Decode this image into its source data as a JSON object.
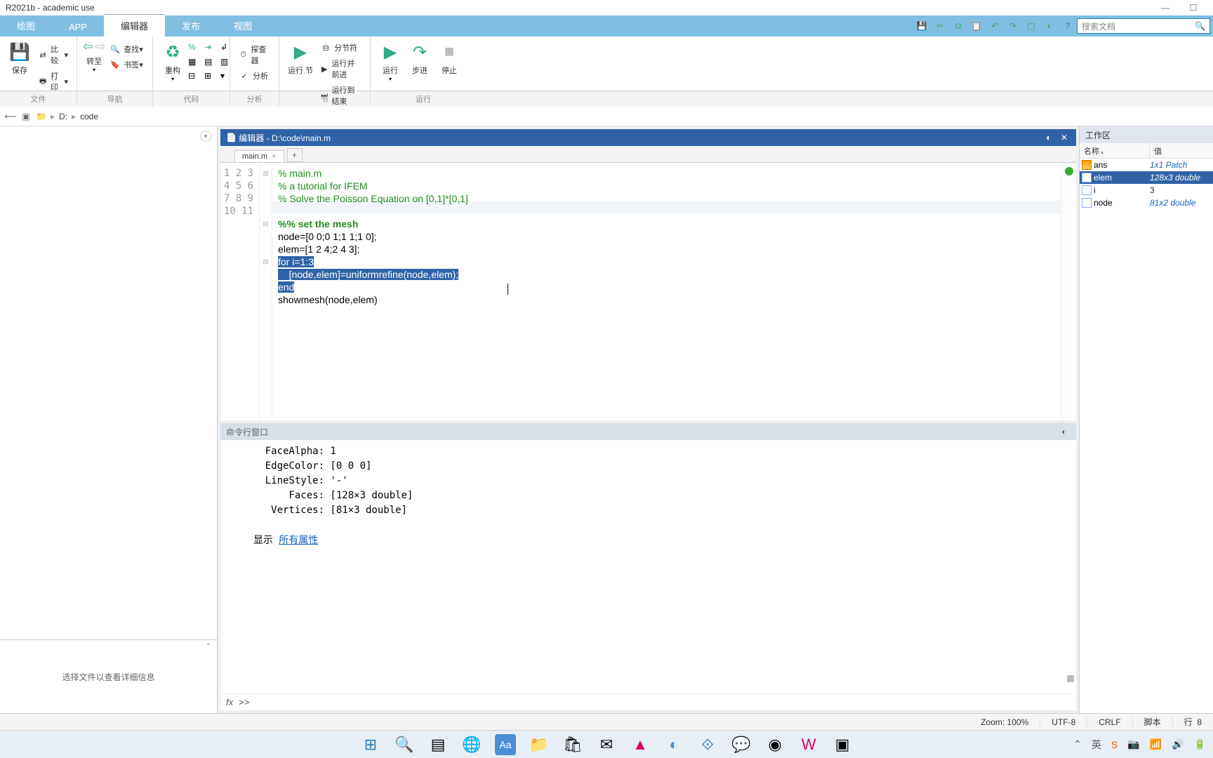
{
  "title": "R2021b - academic use",
  "tabs": [
    "绘图",
    "APP",
    "编辑器",
    "发布",
    "视图"
  ],
  "activeTab": "编辑器",
  "searchPlaceholder": "搜索文档",
  "ribbon": {
    "file": {
      "save": "保存",
      "compare": "比较",
      "print": "打印"
    },
    "nav": {
      "nav": "转至",
      "find": "查找",
      "bookmark": "书签"
    },
    "refactor": "重构",
    "analyze": {
      "explore": "探查器",
      "analyze": "分析"
    },
    "section": {
      "runsection": "运行\n节",
      "break": "分节符",
      "runadvance": "运行并前进",
      "runend": "运行到结束"
    },
    "run": {
      "run": "运行",
      "step": "步进",
      "stop": "停止"
    },
    "labels": [
      "文件",
      "导航",
      "代码",
      "分析",
      "节",
      "运行"
    ]
  },
  "path": {
    "drive": "D:",
    "folder": "code"
  },
  "editorTitle": "编辑器 - D:\\code\\main.m",
  "fileTab": "main.m",
  "code": {
    "lines": [
      {
        "n": 1,
        "type": "comment",
        "text": "% main.m"
      },
      {
        "n": 2,
        "type": "comment",
        "text": "% a tutorial for IFEM"
      },
      {
        "n": 3,
        "type": "comment",
        "text": "% Solve the Poisson Equation on [0,1]*[0,1]"
      },
      {
        "n": 4,
        "type": "blank",
        "text": ""
      },
      {
        "n": 5,
        "type": "section",
        "text": "%% set the mesh"
      },
      {
        "n": 6,
        "type": "code",
        "text": "node=[0 0;0 1;1 1;1 0];"
      },
      {
        "n": 7,
        "type": "code",
        "text": "elem=[1 2 4;2 4 3];"
      },
      {
        "n": 8,
        "type": "sel",
        "text": "for i=1:3",
        "kw": "for"
      },
      {
        "n": 9,
        "type": "sel",
        "text": "    [node,elem]=uniformrefine(node,elem);",
        "indent": true
      },
      {
        "n": 10,
        "type": "sel",
        "text": "end",
        "kw": "end"
      },
      {
        "n": 11,
        "type": "code",
        "text": "showmesh(node,elem)"
      }
    ]
  },
  "cmdTitle": "命令行窗口",
  "cmdOutput": [
    "    FaceAlpha: 1",
    "    EdgeColor: [0 0 0]",
    "    LineStyle: '-'",
    "        Faces: [128×3 double]",
    "     Vertices: [81×3 double]",
    "",
    "  显示 "
  ],
  "cmdLink": "所有属性",
  "prompt": ">>",
  "workspace": {
    "title": "工作区",
    "headers": [
      "名称",
      "值"
    ],
    "vars": [
      {
        "name": "ans",
        "value": "1x1 Patch",
        "italic": true,
        "icontype": "grid"
      },
      {
        "name": "elem",
        "value": "128x3 double",
        "italic": true,
        "icontype": "matrix",
        "selected": true
      },
      {
        "name": "i",
        "value": "3",
        "italic": false,
        "icontype": "matrix"
      },
      {
        "name": "node",
        "value": "81x2 double",
        "italic": true,
        "icontype": "matrix"
      }
    ]
  },
  "details": "选择文件以查看详细信息",
  "status": {
    "zoom": "Zoom: 100%",
    "enc": "UTF-8",
    "eol": "CRLF",
    "type": "脚本",
    "line": "行",
    "linenum": "8"
  }
}
